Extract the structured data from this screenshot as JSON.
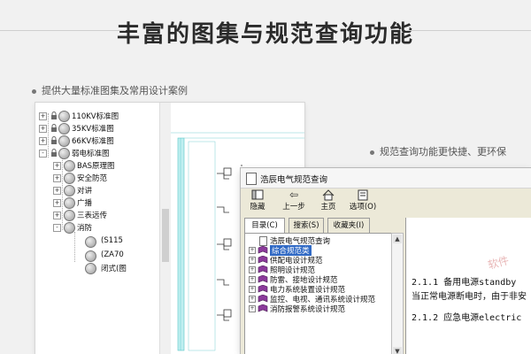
{
  "heading": "丰富的图集与规范查询功能",
  "caption_left": "提供大量标准图集及常用设计案例",
  "caption_right": "规范查询功能更快捷、更环保",
  "tree_window": {
    "items": [
      {
        "label": "110KV标准图",
        "icon": "lock-icon",
        "expander": "+"
      },
      {
        "label": "35KV标准图",
        "icon": "lock-icon",
        "expander": "+"
      },
      {
        "label": "66KV标准图",
        "icon": "lock-icon",
        "expander": "+"
      },
      {
        "label": "弱电标准图",
        "icon": "lock-icon",
        "expander": "-"
      },
      {
        "label": "BAS原理图",
        "icon": "globe-icon",
        "expander": "+"
      },
      {
        "label": "安全防范",
        "icon": "globe-icon",
        "expander": "+"
      },
      {
        "label": "对讲",
        "icon": "globe-icon",
        "expander": "+"
      },
      {
        "label": "广播",
        "icon": "globe-icon",
        "expander": "+"
      },
      {
        "label": "三表远传",
        "icon": "globe-icon",
        "expander": "+"
      },
      {
        "label": "消防",
        "icon": "globe-icon",
        "expander": "-"
      },
      {
        "label": "(S115",
        "icon": "globe-icon",
        "expander": ""
      },
      {
        "label": "(ZA70",
        "icon": "globe-icon",
        "expander": ""
      },
      {
        "label": "闭式(图",
        "icon": "globe-icon",
        "expander": ""
      }
    ]
  },
  "query_window": {
    "title": "浩辰电气规范查询",
    "toolbar": [
      {
        "label": "隐藏",
        "icon": "hide-icon"
      },
      {
        "label": "上一步",
        "icon": "back-arrow-icon"
      },
      {
        "label": "主页",
        "icon": "home-icon"
      },
      {
        "label": "选项(O)",
        "icon": "options-icon"
      }
    ],
    "tabs": [
      "目录(C)",
      "搜索(S)",
      "收藏夹(I)"
    ],
    "tree": [
      {
        "label": "浩辰电气规范查询",
        "icon": "document-icon",
        "expander": ""
      },
      {
        "label": "综合规范类",
        "icon": "book-icon",
        "expander": "+",
        "selected": true
      },
      {
        "label": "供配电设计规范",
        "icon": "book-icon",
        "expander": "+"
      },
      {
        "label": "照明设计规范",
        "icon": "book-icon",
        "expander": "+"
      },
      {
        "label": "防雷、接地设计规范",
        "icon": "book-icon",
        "expander": "+"
      },
      {
        "label": "电力系统装置设计规范",
        "icon": "book-icon",
        "expander": "+"
      },
      {
        "label": "监控、电视、通讯系统设计规范",
        "icon": "book-icon",
        "expander": "+"
      },
      {
        "label": "消防报警系统设计规范",
        "icon": "book-icon",
        "expander": "+"
      }
    ],
    "content": [
      "2.1.1 备用电源standby",
      "当正常电源断电时，由于非安",
      "2.1.2 应急电源electric"
    ],
    "watermark": "软件"
  }
}
